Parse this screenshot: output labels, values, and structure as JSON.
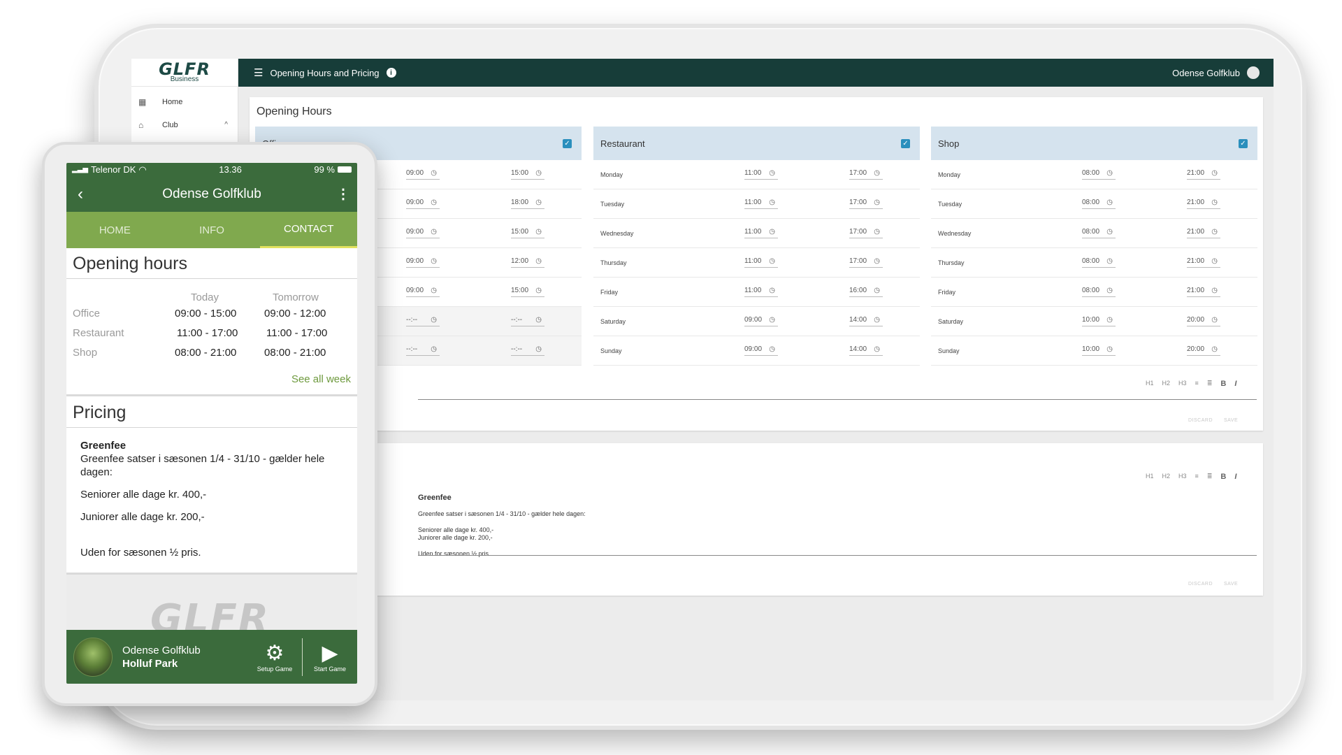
{
  "web": {
    "brand": {
      "logo": "GLFR",
      "sub": "Business"
    },
    "sidebar": {
      "items": [
        {
          "label": "Home"
        },
        {
          "label": "Club"
        }
      ]
    },
    "topbar": {
      "title": "Opening Hours and Pricing",
      "club": "Odense Golfklub"
    },
    "opening_hours": {
      "title": "Opening Hours",
      "columns": [
        {
          "name": "Office",
          "rows": [
            {
              "day": "",
              "open": "09:00",
              "close": "15:00"
            },
            {
              "day": "",
              "open": "09:00",
              "close": "18:00"
            },
            {
              "day": "",
              "open": "09:00",
              "close": "15:00"
            },
            {
              "day": "",
              "open": "09:00",
              "close": "12:00"
            },
            {
              "day": "",
              "open": "09:00",
              "close": "15:00"
            },
            {
              "day": "",
              "open": "--:--",
              "close": "--:--"
            },
            {
              "day": "",
              "open": "--:--",
              "close": "--:--"
            }
          ]
        },
        {
          "name": "Restaurant",
          "rows": [
            {
              "day": "Monday",
              "open": "11:00",
              "close": "17:00"
            },
            {
              "day": "Tuesday",
              "open": "11:00",
              "close": "17:00"
            },
            {
              "day": "Wednesday",
              "open": "11:00",
              "close": "17:00"
            },
            {
              "day": "Thursday",
              "open": "11:00",
              "close": "17:00"
            },
            {
              "day": "Friday",
              "open": "11:00",
              "close": "16:00"
            },
            {
              "day": "Saturday",
              "open": "09:00",
              "close": "14:00"
            },
            {
              "day": "Sunday",
              "open": "09:00",
              "close": "14:00"
            }
          ]
        },
        {
          "name": "Shop",
          "rows": [
            {
              "day": "Monday",
              "open": "08:00",
              "close": "21:00"
            },
            {
              "day": "Tuesday",
              "open": "08:00",
              "close": "21:00"
            },
            {
              "day": "Wednesday",
              "open": "08:00",
              "close": "21:00"
            },
            {
              "day": "Thursday",
              "open": "08:00",
              "close": "21:00"
            },
            {
              "day": "Friday",
              "open": "08:00",
              "close": "21:00"
            },
            {
              "day": "Saturday",
              "open": "10:00",
              "close": "20:00"
            },
            {
              "day": "Sunday",
              "open": "10:00",
              "close": "20:00"
            }
          ]
        }
      ]
    },
    "editor": {
      "h1": "H1",
      "h2": "H2",
      "h3": "H3",
      "bold": "B",
      "italic": "I",
      "discard": "DISCARD",
      "save": "SAVE"
    },
    "pricing": {
      "heading": "Greenfee",
      "lines": [
        "Greenfee satser i sæsonen 1/4 - 31/10 - gælder hele dagen:",
        "Seniorer alle dage kr. 400,-",
        "Juniorer alle dage kr. 200,-",
        "Uden for sæsonen ½ pris."
      ]
    }
  },
  "phone": {
    "status": {
      "carrier": "Telenor DK",
      "time": "13.36",
      "battery": "99 %"
    },
    "header": {
      "title": "Odense Golfklub"
    },
    "tabs": [
      {
        "label": "HOME"
      },
      {
        "label": "INFO"
      },
      {
        "label": "CONTACT"
      }
    ],
    "opening": {
      "title": "Opening hours",
      "today": "Today",
      "tomorrow": "Tomorrow",
      "rows": [
        {
          "label": "Office",
          "today": "09:00 - 15:00",
          "tomorrow": "09:00 - 12:00"
        },
        {
          "label": "Restaurant",
          "today": "11:00 - 17:00",
          "tomorrow": "11:00 - 17:00"
        },
        {
          "label": "Shop",
          "today": "08:00 - 21:00",
          "tomorrow": "08:00 - 21:00"
        }
      ],
      "see_all": "See all week"
    },
    "pricing": {
      "title": "Pricing",
      "heading": "Greenfee",
      "line1": "Greenfee satser i sæsonen 1/4 - 31/10 - gælder hele dagen:",
      "line2": "Seniorer alle dage kr. 400,-",
      "line3": "Juniorer alle dage kr. 200,-",
      "line4": "Uden for sæsonen ½ pris."
    },
    "logo": "GLFR",
    "footer": {
      "club": "Odense Golfklub",
      "course": "Holluf Park",
      "setup": "Setup Game",
      "start": "Start Game"
    }
  }
}
